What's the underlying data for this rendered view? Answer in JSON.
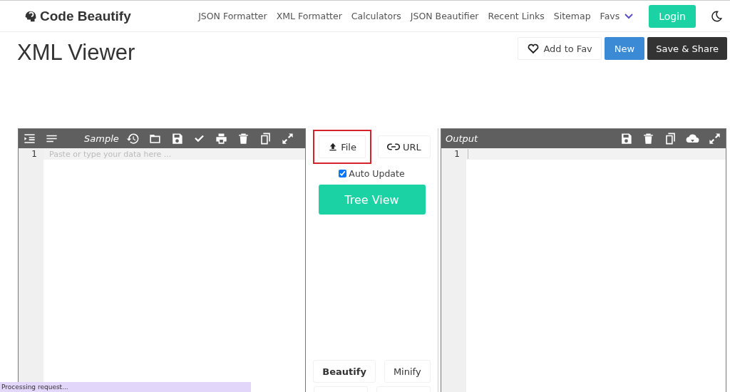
{
  "nav": {
    "brand": "Code Beautify",
    "links": [
      "JSON Formatter",
      "XML Formatter",
      "Calculators",
      "JSON Beautifier",
      "Recent Links",
      "Sitemap",
      "Favs"
    ],
    "login": "Login"
  },
  "page": {
    "title": "XML Viewer",
    "actions": [
      {
        "label": "Add to Fav",
        "kind": "fav"
      },
      {
        "label": "New",
        "kind": "primary"
      },
      {
        "label": "Save & Share",
        "kind": "dark"
      }
    ]
  },
  "input_editor": {
    "sample_label": "Sample",
    "line_numbers": [
      "1"
    ],
    "placeholder": "Paste or type your data here ..."
  },
  "middle": {
    "file_button": {
      "label": "File",
      "highlighted": true
    },
    "url_button": "URL",
    "auto_update": {
      "label": "Auto Update",
      "checked": true
    },
    "tree_view": "Tree View",
    "beautify": "Beautify",
    "minify": "Minify"
  },
  "output_editor": {
    "title": "Output",
    "line_numbers": [
      "1"
    ]
  },
  "status": "Processing request..."
}
